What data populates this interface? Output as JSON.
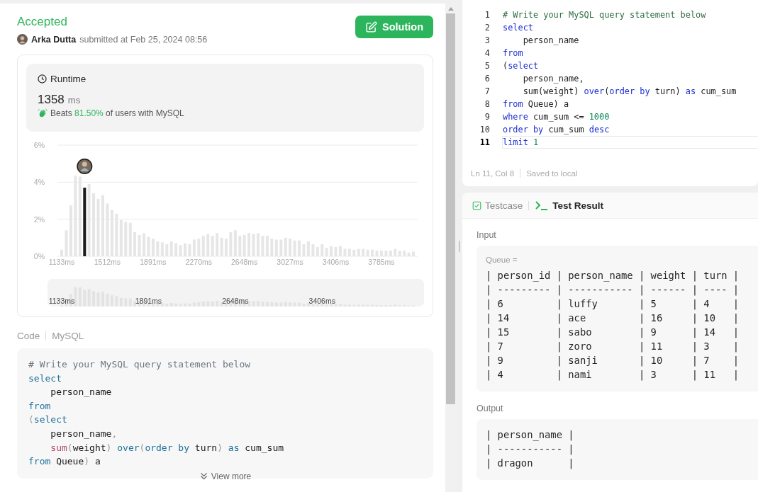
{
  "submission": {
    "status": "Accepted",
    "author": "Arka Dutta",
    "submitted": "submitted at Feb 25, 2024 08:56",
    "solution_button": "Solution"
  },
  "runtime": {
    "label": "Runtime",
    "value": "1358",
    "unit": "ms",
    "beats_prefix": "Beats",
    "beats_value": "81.50%",
    "beats_suffix": "of users with MySQL",
    "chart_data": {
      "type": "bar",
      "ylim": [
        0,
        6
      ],
      "xlim": [
        1133,
        4050
      ],
      "yticks": [
        {
          "value": 0,
          "label": "0%"
        },
        {
          "value": 2,
          "label": "2%"
        },
        {
          "value": 4,
          "label": "4%"
        },
        {
          "value": 6,
          "label": "6%"
        }
      ],
      "xticks": [
        {
          "value": 1133,
          "label": "1133ms"
        },
        {
          "value": 1512,
          "label": "1512ms"
        },
        {
          "value": 1891,
          "label": "1891ms"
        },
        {
          "value": 2270,
          "label": "2270ms"
        },
        {
          "value": 2648,
          "label": "2648ms"
        },
        {
          "value": 3027,
          "label": "3027ms"
        },
        {
          "value": 3406,
          "label": "3406ms"
        },
        {
          "value": 3785,
          "label": "3785ms"
        }
      ],
      "x": [
        1133,
        1171,
        1209,
        1247,
        1285,
        1323,
        1360,
        1398,
        1436,
        1474,
        1512,
        1550,
        1588,
        1626,
        1664,
        1702,
        1739,
        1777,
        1815,
        1853,
        1891,
        1929,
        1967,
        2005,
        2043,
        2081,
        2118,
        2156,
        2194,
        2232,
        2270,
        2308,
        2346,
        2384,
        2422,
        2460,
        2497,
        2535,
        2573,
        2611,
        2648,
        2686,
        2724,
        2762,
        2800,
        2838,
        2876,
        2914,
        2952,
        2990,
        3027,
        3065,
        3103,
        3141,
        3179,
        3217,
        3255,
        3293,
        3330,
        3368,
        3406,
        3444,
        3482,
        3520,
        3558,
        3596,
        3633,
        3671,
        3709,
        3747,
        3785,
        3823,
        3861,
        3899,
        3937,
        3975,
        4012,
        4050
      ],
      "series": [
        {
          "color": "#e6e6e6",
          "values": [
            0.35,
            1.4,
            2.75,
            4.35,
            4.3,
            null,
            3.9,
            3.4,
            3.1,
            3.3,
            2.85,
            2.5,
            2.3,
            1.95,
            1.85,
            1.8,
            1.3,
            1.15,
            1.25,
            1.05,
            0.95,
            0.8,
            0.75,
            0.65,
            0.8,
            0.7,
            0.6,
            0.7,
            0.65,
            0.9,
            0.95,
            1.1,
            1.2,
            1.1,
            1.25,
            1.0,
            0.95,
            1.3,
            1.4,
            1.1,
            1.15,
            1.25,
            1.2,
            1.25,
            1.1,
            1.1,
            0.95,
            0.9,
            0.9,
            1.0,
            0.95,
            0.85,
            0.85,
            0.65,
            0.8,
            0.65,
            0.5,
            0.65,
            0.45,
            0.55,
            0.5,
            0.55,
            0.4,
            0.4,
            0.35,
            0.4,
            0.4,
            0.35,
            0.35,
            0.3,
            0.3,
            0.3,
            0.3,
            0.4,
            0.3,
            0.3,
            0.2,
            0.25
          ]
        },
        {
          "color": "#1a1a1a",
          "values": [
            null,
            null,
            null,
            null,
            null,
            3.7,
            null,
            null,
            null,
            null,
            null,
            null,
            null,
            null,
            null,
            null,
            null,
            null,
            null,
            null,
            null,
            null,
            null,
            null,
            null,
            null,
            null,
            null,
            null,
            null,
            null,
            null,
            null,
            null,
            null,
            null,
            null,
            null,
            null,
            null,
            null,
            null,
            null,
            null,
            null,
            null,
            null,
            null,
            null,
            null,
            null,
            null,
            null,
            null,
            null,
            null,
            null,
            null,
            null,
            null,
            null,
            null,
            null,
            null,
            null,
            null,
            null,
            null,
            null,
            null,
            null,
            null,
            null,
            null,
            null,
            null,
            null,
            null
          ]
        }
      ]
    },
    "overview_labels": [
      "1133ms",
      "1891ms",
      "2648ms",
      "3406ms"
    ]
  },
  "code_view": {
    "label": "Code",
    "language": "MySQL",
    "view_more": "View more",
    "lines": [
      [
        {
          "kind": "comment",
          "text": "# Write your MySQL query statement below"
        }
      ],
      [
        {
          "kind": "keyword",
          "text": "select"
        }
      ],
      [
        {
          "kind": "plain",
          "text": "    person_name"
        }
      ],
      [
        {
          "kind": "keyword",
          "text": "from"
        }
      ],
      [
        {
          "kind": "punct",
          "text": "("
        },
        {
          "kind": "keyword",
          "text": "select"
        }
      ],
      [
        {
          "kind": "plain",
          "text": "    person_name"
        },
        {
          "kind": "punct",
          "text": ","
        }
      ],
      [
        {
          "kind": "function",
          "text": "    sum"
        },
        {
          "kind": "punct",
          "text": "("
        },
        {
          "kind": "plain",
          "text": "weight"
        },
        {
          "kind": "punct",
          "text": ")"
        },
        {
          "kind": "keyword",
          "text": " over"
        },
        {
          "kind": "punct",
          "text": "("
        },
        {
          "kind": "keyword",
          "text": "order by"
        },
        {
          "kind": "plain",
          "text": " turn"
        },
        {
          "kind": "punct",
          "text": ")"
        },
        {
          "kind": "keyword",
          "text": " as"
        },
        {
          "kind": "plain",
          "text": " cum_sum"
        }
      ],
      [
        {
          "kind": "keyword",
          "text": "from"
        },
        {
          "kind": "plain",
          "text": " Queue"
        },
        {
          "kind": "punct",
          "text": ")"
        },
        {
          "kind": "plain",
          "text": " a"
        }
      ]
    ]
  },
  "editor": {
    "cursor": "Ln 11, Col 8",
    "save_state": "Saved to local",
    "lines": [
      {
        "number": "1",
        "active": false,
        "tokens": [
          {
            "kind": "comment",
            "text": "# Write your MySQL query statement below"
          }
        ]
      },
      {
        "number": "2",
        "active": false,
        "tokens": [
          {
            "kind": "keyword",
            "text": "select"
          }
        ]
      },
      {
        "number": "3",
        "active": false,
        "tokens": [
          {
            "kind": "plain",
            "text": "    person_name"
          }
        ]
      },
      {
        "number": "4",
        "active": false,
        "tokens": [
          {
            "kind": "keyword",
            "text": "from"
          }
        ]
      },
      {
        "number": "5",
        "active": false,
        "tokens": [
          {
            "kind": "plain",
            "text": "("
          },
          {
            "kind": "keyword",
            "text": "select"
          }
        ]
      },
      {
        "number": "6",
        "active": false,
        "tokens": [
          {
            "kind": "plain",
            "text": "    person_name,"
          }
        ]
      },
      {
        "number": "7",
        "active": false,
        "tokens": [
          {
            "kind": "plain",
            "text": "    sum(weight) "
          },
          {
            "kind": "keyword",
            "text": "over"
          },
          {
            "kind": "plain",
            "text": "("
          },
          {
            "kind": "keyword",
            "text": "order by"
          },
          {
            "kind": "plain",
            "text": " turn) "
          },
          {
            "kind": "keyword",
            "text": "as"
          },
          {
            "kind": "plain",
            "text": " cum_sum"
          }
        ]
      },
      {
        "number": "8",
        "active": false,
        "tokens": [
          {
            "kind": "keyword",
            "text": "from"
          },
          {
            "kind": "plain",
            "text": " Queue) a"
          }
        ]
      },
      {
        "number": "9",
        "active": false,
        "tokens": [
          {
            "kind": "keyword",
            "text": "where"
          },
          {
            "kind": "plain",
            "text": " cum_sum <= "
          },
          {
            "kind": "number",
            "text": "1000"
          }
        ]
      },
      {
        "number": "10",
        "active": false,
        "tokens": [
          {
            "kind": "keyword",
            "text": "order by"
          },
          {
            "kind": "plain",
            "text": " cum_sum "
          },
          {
            "kind": "keyword",
            "text": "desc"
          }
        ]
      },
      {
        "number": "11",
        "active": true,
        "tokens": [
          {
            "kind": "keyword",
            "text": "limit"
          },
          {
            "kind": "number",
            "text": " 1"
          }
        ]
      }
    ]
  },
  "console": {
    "tabs": [
      {
        "label": "Testcase",
        "selected": false,
        "kind": "testcase"
      },
      {
        "label": "Test Result",
        "selected": true,
        "kind": "result"
      }
    ],
    "input_label": "Input",
    "input_name": "Queue =",
    "input_lines": [
      "| person_id | person_name | weight | turn |",
      "| --------- | ----------- | ------ | ---- |",
      "| 6         | luffy       | 5      | 4    |",
      "| 14        | ace         | 16     | 10   |",
      "| 15        | sabo        | 9      | 14   |",
      "| 7         | zoro        | 11     | 3    |",
      "| 9         | sanji       | 10     | 7    |",
      "| 4         | nami        | 3      | 11   |"
    ],
    "output_label": "Output",
    "output_lines": [
      "| person_name |",
      "| ----------- |",
      "| dragon      |"
    ]
  }
}
